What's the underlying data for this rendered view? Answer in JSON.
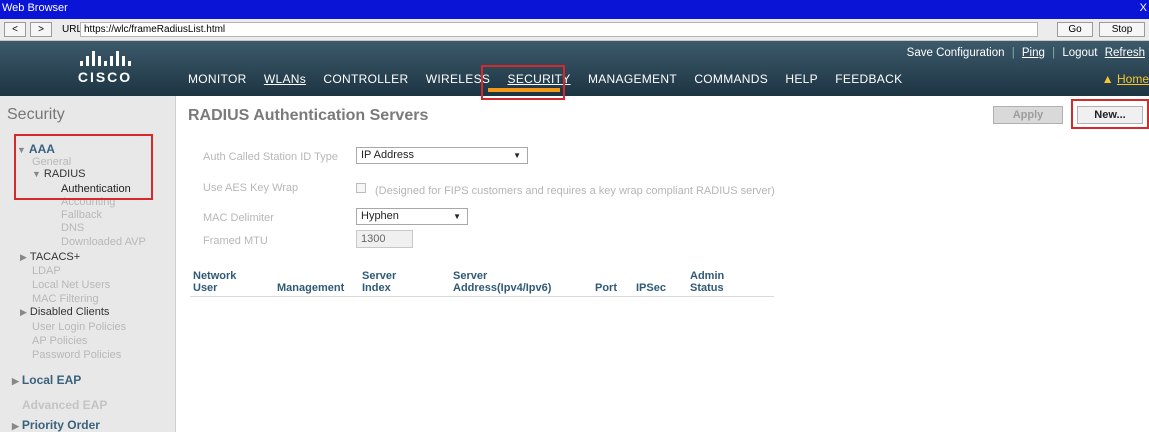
{
  "browser": {
    "window_title": "Web Browser",
    "close": "X",
    "back": "<",
    "forward": ">",
    "url_label": "URL",
    "url": "https://wlc/frameRadiusList.html",
    "go": "Go",
    "stop": "Stop"
  },
  "brand": {
    "logo_word": "CISCO"
  },
  "toplinks": {
    "save": "Save Configuration",
    "ping": "Ping",
    "logout": "Logout",
    "refresh": "Refresh"
  },
  "menu": {
    "items": [
      "MONITOR",
      "WLANs",
      "CONTROLLER",
      "WIRELESS",
      "SECURITY",
      "MANAGEMENT",
      "COMMANDS",
      "HELP",
      "FEEDBACK"
    ],
    "active": "SECURITY",
    "home": "Home"
  },
  "sidebar": {
    "title": "Security",
    "aaa": "AAA",
    "general": "General",
    "radius": "RADIUS",
    "authentication": "Authentication",
    "accounting": "Accounting",
    "fallback": "Fallback",
    "dns": "DNS",
    "downloaded_avp": "Downloaded AVP",
    "tacacs": "TACACS+",
    "ldap": "LDAP",
    "local_net_users": "Local Net Users",
    "mac_filtering": "MAC Filtering",
    "disabled_clients": "Disabled Clients",
    "user_login_policies": "User Login Policies",
    "ap_policies": "AP Policies",
    "password_policies": "Password Policies",
    "local_eap": "Local EAP",
    "advanced_eap": "Advanced EAP",
    "priority_order": "Priority Order"
  },
  "main": {
    "title": "RADIUS Authentication Servers",
    "apply": "Apply",
    "new": "New...",
    "fields": {
      "auth_called_label": "Auth Called Station ID Type",
      "auth_called_value": "IP Address",
      "aes_label": "Use AES Key Wrap",
      "aes_note": "(Designed for FIPS customers and requires a key wrap compliant RADIUS server)",
      "mac_label": "MAC Delimiter",
      "mac_value": "Hyphen",
      "mtu_label": "Framed MTU",
      "mtu_value": "1300"
    },
    "table_headers": {
      "network_user_1": "Network",
      "network_user_2": "User",
      "management": "Management",
      "server_index_1": "Server",
      "server_index_2": "Index",
      "server_address_1": "Server",
      "server_address_2": "Address(Ipv4/Ipv6)",
      "port": "Port",
      "ipsec": "IPSec",
      "admin_status_1": "Admin",
      "admin_status_2": "Status"
    }
  },
  "colors": {
    "titlebar": "#0a14d6",
    "header_top": "#3c5a6b",
    "header_bottom": "#1d3442",
    "active_underline": "#f39a1d",
    "highlight_box": "#d32b2b",
    "section_heading": "#39627d"
  }
}
